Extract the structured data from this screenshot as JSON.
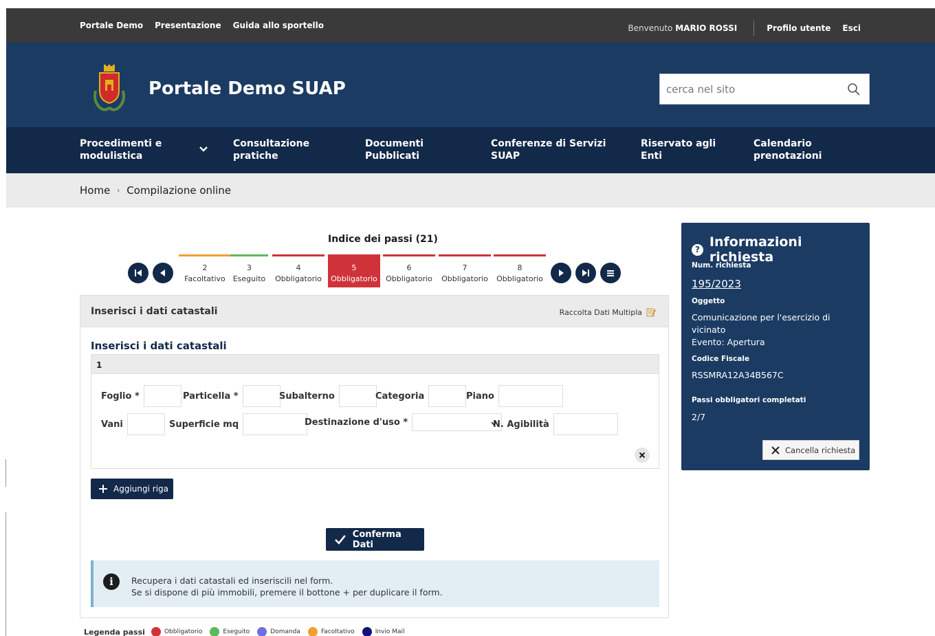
{
  "topbar": {
    "links": [
      "Portale Demo",
      "Presentazione",
      "Guida allo sportello"
    ],
    "welcome_prefix": "Benvenuto",
    "user_name": "MARIO ROSSI",
    "profile": "Profilo utente",
    "logout": "Esci"
  },
  "header": {
    "title": "Portale Demo SUAP",
    "search_placeholder": "cerca nel sito"
  },
  "nav": [
    {
      "line1": "Procedimenti e",
      "line2": "modulistica"
    },
    {
      "line1": "Consultazione",
      "line2": "pratiche"
    },
    {
      "line1": "Documenti",
      "line2": "Pubblicati"
    },
    {
      "line1": "Conferenze di Servizi",
      "line2": "SUAP"
    },
    {
      "line1": "Riservato agli",
      "line2": "Enti"
    },
    {
      "line1": "Calendario",
      "line2": "prenotazioni"
    }
  ],
  "breadcrumb": {
    "home": "Home",
    "current": "Compilazione online"
  },
  "stepper": {
    "title": "Indice dei passi (21)",
    "steps": [
      {
        "num": "2",
        "label": "Facoltativo",
        "color": "#f0a030"
      },
      {
        "num": "3",
        "label": "Eseguito",
        "color": "#5cb85c"
      },
      {
        "num": "4",
        "label": "Obbligatorio",
        "color": "#cf3339"
      },
      {
        "num": "5",
        "label": "Obbligatorio",
        "color": "#cf3339"
      },
      {
        "num": "6",
        "label": "Obbligatorio",
        "color": "#cf3339"
      },
      {
        "num": "7",
        "label": "Obbligatorio",
        "color": "#cf3339"
      },
      {
        "num": "8",
        "label": "Obbligatorio",
        "color": "#cf3339"
      }
    ]
  },
  "panel": {
    "header_title": "Inserisci i dati catastali",
    "multi_label": "Raccolta Dati Multipla",
    "subtitle": "Inserisci i dati catastali",
    "row_num": "1",
    "fields": {
      "foglio": "Foglio *",
      "particella": "Particella *",
      "subalterno": "Subalterno",
      "categoria": "Categoria",
      "piano": "Piano",
      "vani": "Vani",
      "superficie": "Superficie mq",
      "destinazione": "Destinazione d'uso *",
      "agibilita": "N. Agibilità"
    },
    "add_row": "Aggiungi riga",
    "confirm": "Conferma Dati",
    "info_line1": "Recupera i dati catastali ed inseriscili nel form.",
    "info_line2": "Se si dispone di più immobili, premere il bottone + per duplicare il form."
  },
  "legend": {
    "title": "Legenda passi",
    "items": [
      {
        "label": "Obbligatorio",
        "color": "#cf3339"
      },
      {
        "label": "Eseguito",
        "color": "#5cb85c"
      },
      {
        "label": "Domanda",
        "color": "#6f6fe0"
      },
      {
        "label": "Facoltativo",
        "color": "#f0a030"
      },
      {
        "label": "Invio Mail",
        "color": "#12127a"
      }
    ]
  },
  "info": {
    "title": "Informazioni richiesta",
    "num_label": "Num. richiesta",
    "num_value": "195/2023",
    "oggetto_label": "Oggetto",
    "oggetto_value": "Comunicazione per l'esercizio di vicinato",
    "evento": "Evento: Apertura",
    "cf_label": "Codice Fiscale",
    "cf_value": "RSSMRA12A34B567C",
    "passi_label": "Passi obbligatori completati",
    "passi_value": "2/7",
    "cancel": "Cancella richiesta"
  }
}
